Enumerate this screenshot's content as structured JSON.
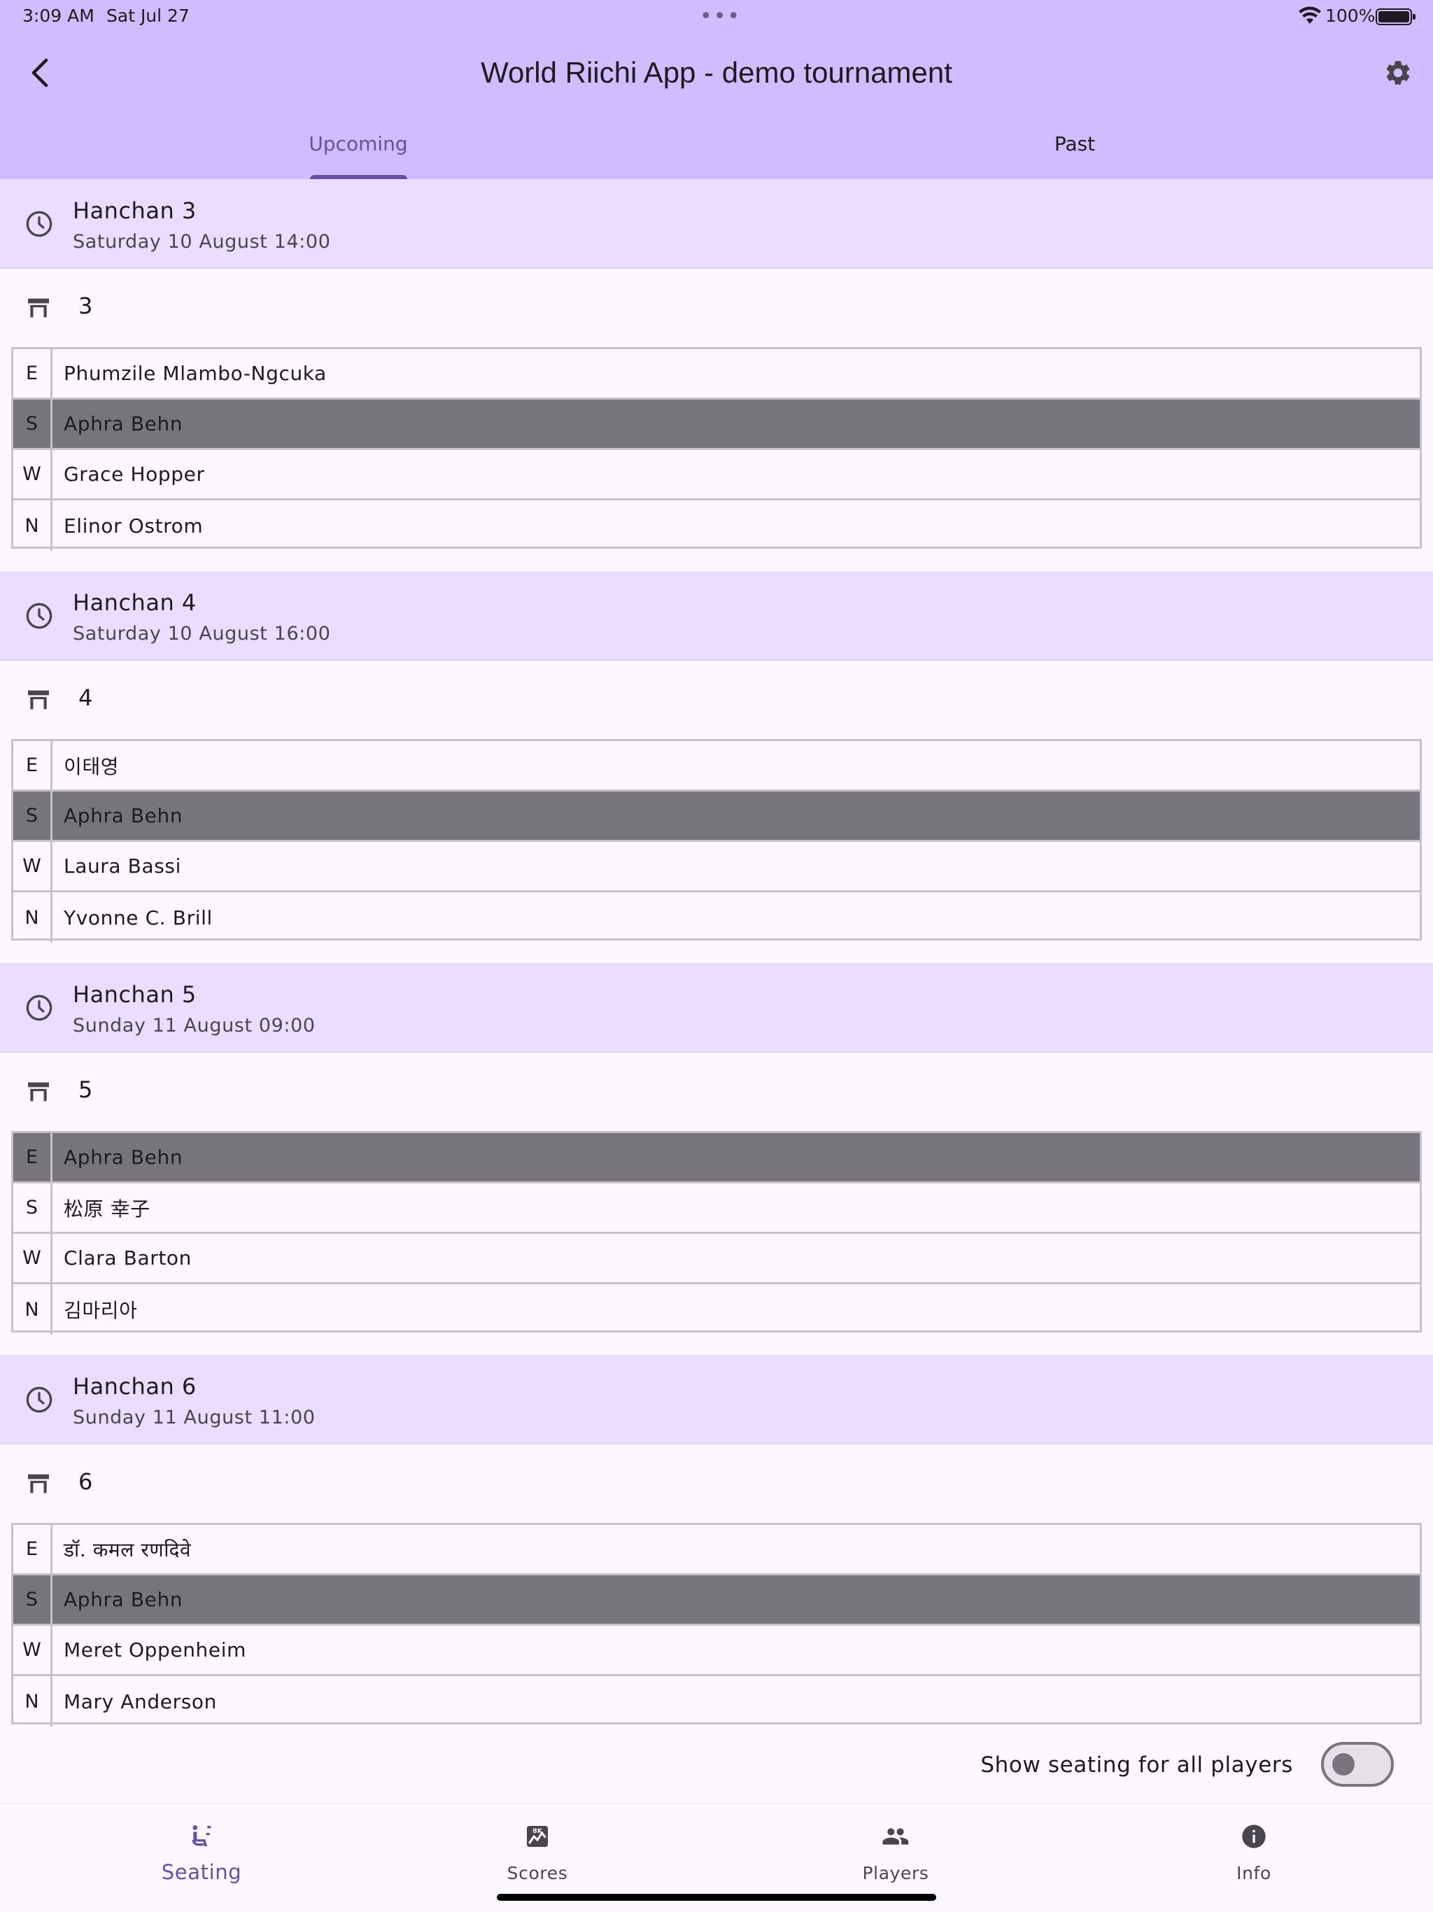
{
  "status_bar": {
    "time": "3:09 AM",
    "date": "Sat Jul 27",
    "dots": "•••",
    "battery_pct": "100%"
  },
  "header": {
    "title": "World Riichi App - demo tournament"
  },
  "tabs": [
    {
      "label": "Upcoming",
      "active": true
    },
    {
      "label": "Past",
      "active": false
    }
  ],
  "rounds": [
    {
      "title": "Hanchan 3",
      "date": "Saturday 10 August 14:00",
      "table": "3",
      "seats": [
        {
          "wind": "E",
          "name": "Phumzile Mlambo-Ngcuka",
          "highlight": false
        },
        {
          "wind": "S",
          "name": "Aphra Behn",
          "highlight": true
        },
        {
          "wind": "W",
          "name": "Grace Hopper",
          "highlight": false
        },
        {
          "wind": "N",
          "name": "Elinor Ostrom",
          "highlight": false
        }
      ]
    },
    {
      "title": "Hanchan 4",
      "date": "Saturday 10 August 16:00",
      "table": "4",
      "seats": [
        {
          "wind": "E",
          "name": "이태영",
          "highlight": false
        },
        {
          "wind": "S",
          "name": "Aphra Behn",
          "highlight": true
        },
        {
          "wind": "W",
          "name": "Laura Bassi",
          "highlight": false
        },
        {
          "wind": "N",
          "name": "Yvonne C. Brill",
          "highlight": false
        }
      ]
    },
    {
      "title": "Hanchan 5",
      "date": "Sunday 11 August 09:00",
      "table": "5",
      "seats": [
        {
          "wind": "E",
          "name": "Aphra Behn",
          "highlight": true
        },
        {
          "wind": "S",
          "name": "松原 幸子",
          "highlight": false
        },
        {
          "wind": "W",
          "name": "Clara Barton",
          "highlight": false
        },
        {
          "wind": "N",
          "name": "김마리아",
          "highlight": false
        }
      ]
    },
    {
      "title": "Hanchan 6",
      "date": "Sunday 11 August 11:00",
      "table": "6",
      "seats": [
        {
          "wind": "E",
          "name": "डॉ. कमल रणदिवे",
          "highlight": false
        },
        {
          "wind": "S",
          "name": "Aphra Behn",
          "highlight": true
        },
        {
          "wind": "W",
          "name": "Meret Oppenheim",
          "highlight": false
        },
        {
          "wind": "N",
          "name": "Mary Anderson",
          "highlight": false
        }
      ]
    }
  ],
  "toggle": {
    "label": "Show seating for all players",
    "on": false
  },
  "bottom_nav": [
    {
      "label": "Seating",
      "icon": "seat-icon",
      "active": true
    },
    {
      "label": "Scores",
      "icon": "scores-icon",
      "active": false
    },
    {
      "label": "Players",
      "icon": "people-icon",
      "active": false
    },
    {
      "label": "Info",
      "icon": "info-icon",
      "active": false
    }
  ],
  "colors": {
    "appbar": "#d0bcff",
    "round_header": "#eaddff",
    "primary": "#6750a4",
    "highlight_row": "#78747c",
    "background": "#fdf7ff"
  }
}
